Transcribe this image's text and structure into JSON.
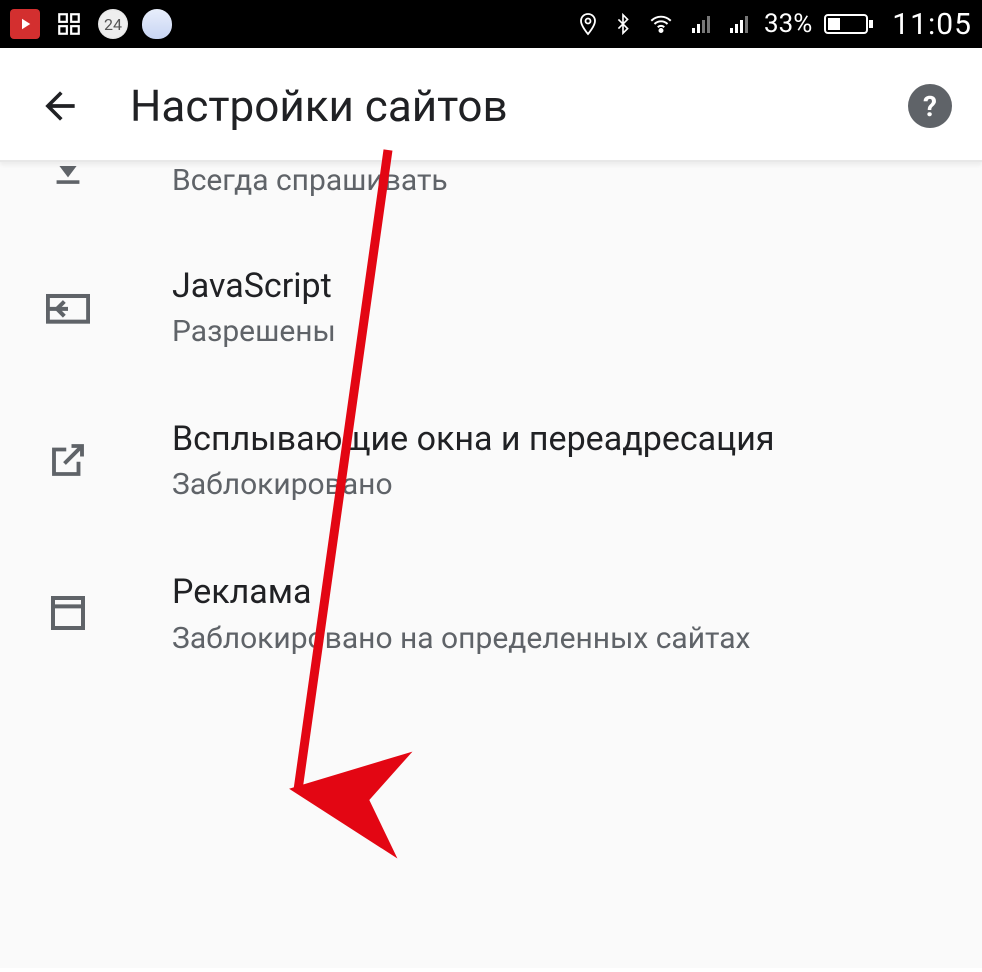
{
  "statusbar": {
    "battery_percent": "33%",
    "clock": "11:05"
  },
  "appbar": {
    "title": "Настройки сайтов"
  },
  "rows": {
    "cutoff": {
      "subtitle": "Всегда спрашивать"
    },
    "javascript": {
      "title": "JavaScript",
      "subtitle": "Разрешены"
    },
    "popups": {
      "title": "Всплывающие окна и переадресация",
      "subtitle": "Заблокировано"
    },
    "ads": {
      "title": "Реклама",
      "subtitle": "Заблокировано на определенных сайтах"
    }
  }
}
